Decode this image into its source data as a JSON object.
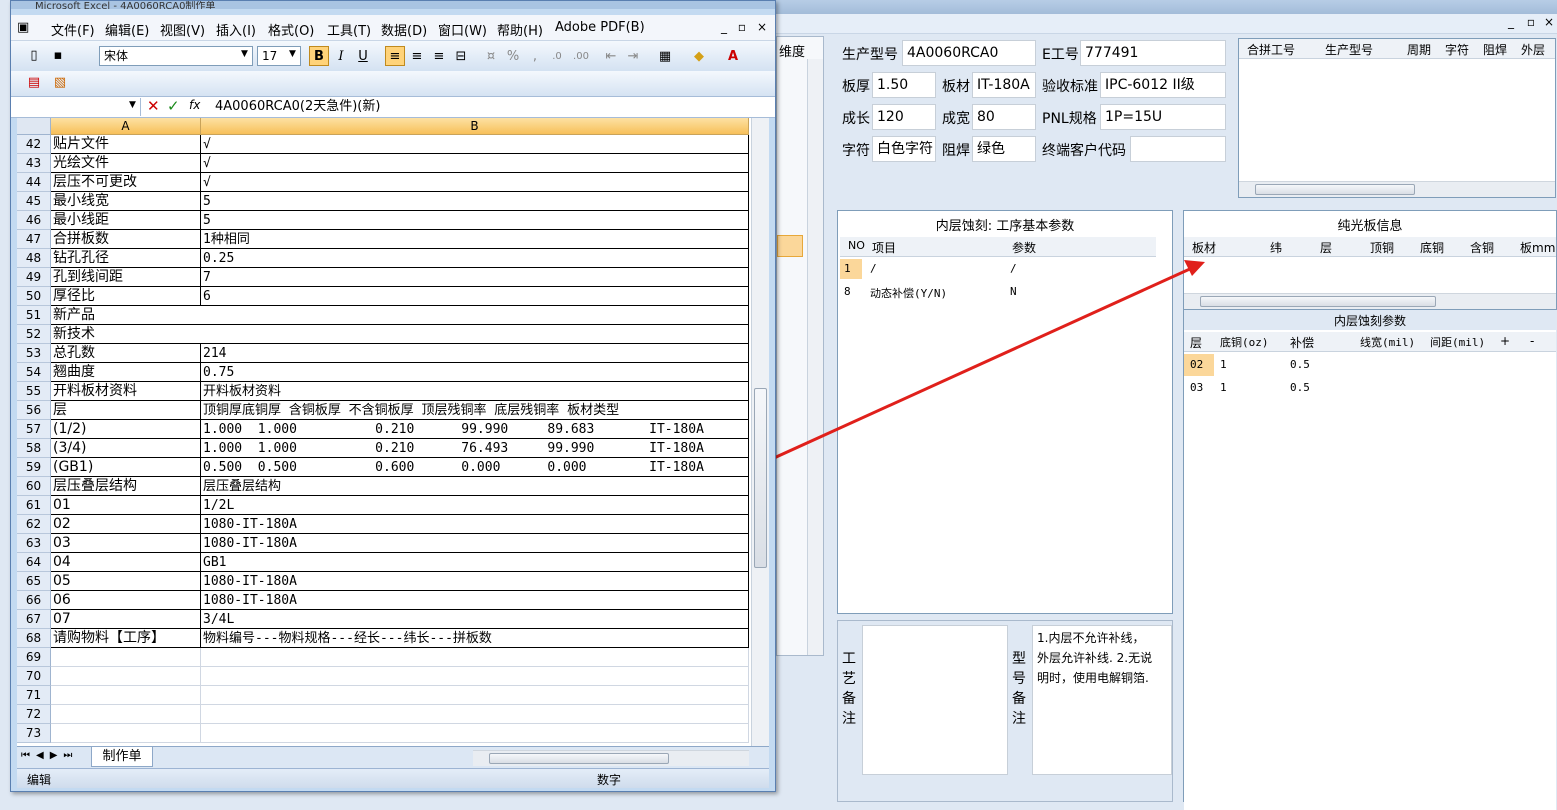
{
  "colors": {
    "accent_red": "#e0201b",
    "header_orange": "#f7c05a",
    "app_bg": "#dfe8f3"
  },
  "bgapp": {
    "window_controls": [
      "_",
      "▫",
      "×"
    ],
    "header_labels": {
      "model": "生产型号",
      "model_value": "4A0060RCA0",
      "e_no": "E工号",
      "e_no_value": "777491",
      "thickness": "板厚",
      "thickness_value": "1.50",
      "material": "板材",
      "material_value": "IT-180A",
      "standard": "验收标准",
      "standard_value": "IPC-6012 II级",
      "length": "成长",
      "length_value": "120",
      "width": "成宽",
      "width_value": "80",
      "pnl": "PNL规格",
      "pnl_value": "1P=15U",
      "silkscreen": "字符",
      "silkscreen_value": "白色字符",
      "soldermask": "阻焊",
      "soldermask_value": "绿色",
      "end_customer": "终端客户代码",
      "end_customer_value": ""
    },
    "left_cut_label": "维度",
    "merge_grid": {
      "columns": [
        "合拼工号",
        "生产型号",
        "周期",
        "字符",
        "阻焊",
        "外层"
      ]
    },
    "inner_etch": {
      "title": "内层蚀刻: 工序基本参数",
      "columns": [
        "NO",
        "项目",
        "参数"
      ],
      "rows": [
        {
          "no": "1",
          "item": "/",
          "param": "/"
        },
        {
          "no": "8",
          "item": "动态补偿(Y/N)",
          "param": "N"
        }
      ]
    },
    "bare_board": {
      "title": "纯光板信息",
      "columns": [
        "板材",
        "纬",
        "层",
        "顶铜",
        "底铜",
        "含铜",
        "板mm"
      ]
    },
    "inner_etch_params": {
      "title": "内层蚀刻参数",
      "columns": [
        "层",
        "底铜(oz)",
        "补偿",
        "线宽(mil)",
        "间距(mil)",
        "+",
        "-"
      ],
      "rows": [
        {
          "layer": "02",
          "base": "1",
          "comp": "0.5"
        },
        {
          "layer": "03",
          "base": "1",
          "comp": "0.5"
        }
      ]
    },
    "process_note_label": "工艺备注",
    "model_note_label": "型号备注",
    "model_note_text": "1.内层不允许补线，外层允许补线. 2.无说明时，使用电解铜箔."
  },
  "excel": {
    "title": "Microsoft Excel - 4A0060RCA0制作单",
    "menu": [
      "文件(F)",
      "编辑(E)",
      "视图(V)",
      "插入(I)",
      "格式(O)",
      "工具(T)",
      "数据(D)",
      "窗口(W)",
      "帮助(H)",
      "Adobe PDF(B)"
    ],
    "font_name": "宋体",
    "font_size": "17",
    "formula": "4A0060RCA0(2天急件)(新)",
    "column_a": "A",
    "column_b": "B",
    "rows": [
      {
        "n": "42",
        "a": "贴片文件",
        "b": "√"
      },
      {
        "n": "43",
        "a": "光绘文件",
        "b": "√"
      },
      {
        "n": "44",
        "a": "层压不可更改",
        "b": "√"
      },
      {
        "n": "45",
        "a": "最小线宽",
        "b": "5"
      },
      {
        "n": "46",
        "a": "最小线距",
        "b": "5"
      },
      {
        "n": "47",
        "a": "合拼板数",
        "b": "1种相同"
      },
      {
        "n": "48",
        "a": "钻孔孔径",
        "b": "0.25"
      },
      {
        "n": "49",
        "a": "孔到线间距",
        "b": "7"
      },
      {
        "n": "50",
        "a": "厚径比",
        "b": "6"
      },
      {
        "n": "51",
        "a": "新产品",
        "b": ""
      },
      {
        "n": "52",
        "a": "新技术",
        "b": ""
      },
      {
        "n": "53",
        "a": "总孔数",
        "b": "214"
      },
      {
        "n": "54",
        "a": "翘曲度",
        "b": "0.75"
      },
      {
        "n": "55",
        "a": "开料板材资料",
        "b": "开料板材资料"
      },
      {
        "n": "56",
        "a": "层",
        "b": "顶铜厚底铜厚 含铜板厚 不含铜板厚 顶层残铜率 底层残铜率 板材类型"
      },
      {
        "n": "57",
        "a": "(1/2)",
        "b": "1.000  1.000          0.210      99.990     89.683       IT-180A"
      },
      {
        "n": "58",
        "a": "(3/4)",
        "b": "1.000  1.000          0.210      76.493     99.990       IT-180A"
      },
      {
        "n": "59",
        "a": "(GB1)",
        "b": "0.500  0.500          0.600      0.000      0.000        IT-180A"
      },
      {
        "n": "60",
        "a": "层压叠层结构",
        "b": "层压叠层结构"
      },
      {
        "n": "61",
        "a": "01",
        "b": "1/2L"
      },
      {
        "n": "62",
        "a": "02",
        "b": "1080-IT-180A"
      },
      {
        "n": "63",
        "a": "03",
        "b": "1080-IT-180A"
      },
      {
        "n": "64",
        "a": "04",
        "b": "GB1"
      },
      {
        "n": "65",
        "a": "05",
        "b": "1080-IT-180A"
      },
      {
        "n": "66",
        "a": "06",
        "b": "1080-IT-180A"
      },
      {
        "n": "67",
        "a": "07",
        "b": "3/4L"
      },
      {
        "n": "68",
        "a": "请购物料【工序】",
        "b": "物料编号---物料规格---经长---纬长---拼板数"
      },
      {
        "n": "69",
        "a": "",
        "b": ""
      },
      {
        "n": "70",
        "a": "",
        "b": ""
      },
      {
        "n": "71",
        "a": "",
        "b": ""
      },
      {
        "n": "72",
        "a": "",
        "b": ""
      },
      {
        "n": "73",
        "a": "",
        "b": ""
      }
    ],
    "sheet_tab": "制作单",
    "status_left": "编辑",
    "status_right": "数字"
  }
}
